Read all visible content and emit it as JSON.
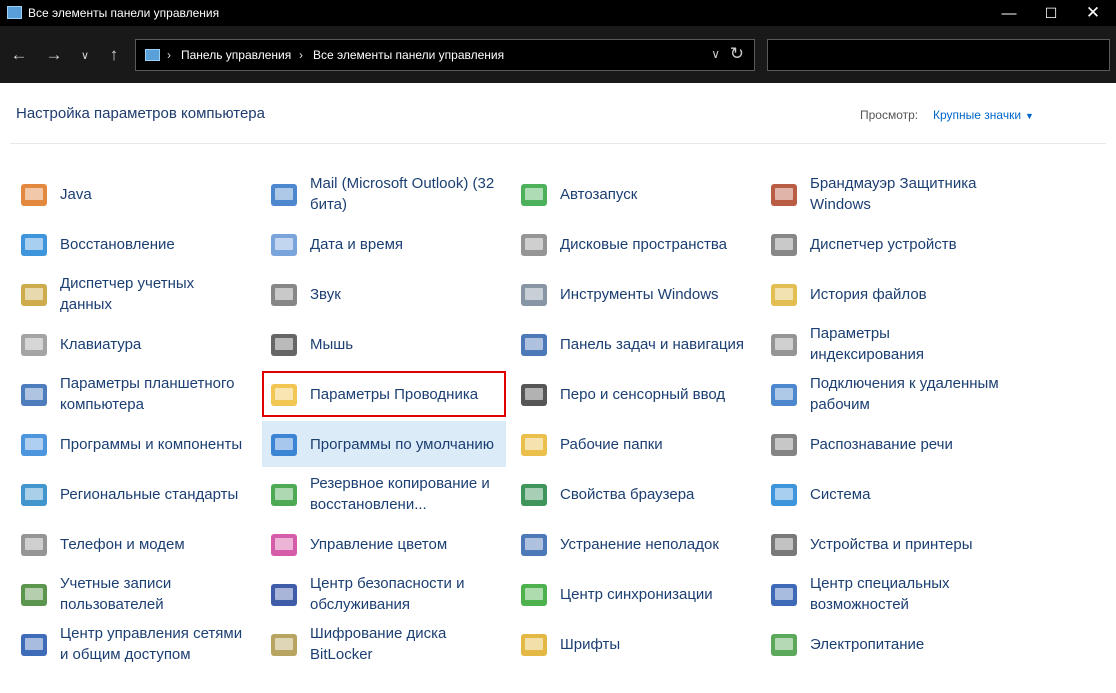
{
  "window": {
    "title": "Все элементы панели управления"
  },
  "address": {
    "crumbs": [
      "Панель управления",
      "Все элементы панели управления"
    ]
  },
  "heading": "Настройка параметров компьютера",
  "view": {
    "label": "Просмотр:",
    "value": "Крупные значки"
  },
  "columns": [
    [
      {
        "label": "Java",
        "icon": "java-icon",
        "color": "#e07b2a"
      },
      {
        "label": "Восстановление",
        "icon": "recovery-icon",
        "color": "#2a8ad8"
      },
      {
        "label": "Диспетчер учетных данных",
        "icon": "credential-manager-icon",
        "color": "#c9a33a"
      },
      {
        "label": "Клавиатура",
        "icon": "keyboard-icon",
        "color": "#9a9a9a"
      },
      {
        "label": "Параметры планшетного компьютера",
        "icon": "tablet-icon",
        "color": "#3a6fb5"
      },
      {
        "label": "Программы и компоненты",
        "icon": "programs-icon",
        "color": "#3a8ad8"
      },
      {
        "label": "Региональные стандарты",
        "icon": "globe-icon",
        "color": "#2f8ac8"
      },
      {
        "label": "Телефон и модем",
        "icon": "phone-icon",
        "color": "#8a8a8a"
      },
      {
        "label": "Учетные записи пользователей",
        "icon": "users-icon",
        "color": "#4a8a3a"
      },
      {
        "label": "Центр управления сетями и общим доступом",
        "icon": "network-icon",
        "color": "#2a5cb0"
      }
    ],
    [
      {
        "label": "Mail (Microsoft Outlook) (32 бита)",
        "icon": "mail-icon",
        "color": "#3a7ac8"
      },
      {
        "label": "Дата и время",
        "icon": "clock-icon",
        "color": "#6a9ad8"
      },
      {
        "label": "Звук",
        "icon": "speaker-icon",
        "color": "#7a7a7a"
      },
      {
        "label": "Мышь",
        "icon": "mouse-icon",
        "color": "#555555"
      },
      {
        "label": "Параметры Проводника",
        "icon": "folder-options-icon",
        "color": "#f0c040"
      },
      {
        "label": "Программы по умолчанию",
        "icon": "default-programs-icon",
        "color": "#2a7ad0"
      },
      {
        "label": "Резервное копирование и восстановлени...",
        "icon": "backup-icon",
        "color": "#3aa040"
      },
      {
        "label": "Управление цветом",
        "icon": "color-icon",
        "color": "#d04aa0"
      },
      {
        "label": "Центр безопасности и обслуживания",
        "icon": "flag-icon",
        "color": "#2a4aa0"
      },
      {
        "label": "Шифрование диска BitLocker",
        "icon": "bitlocker-icon",
        "color": "#b09a50"
      }
    ],
    [
      {
        "label": "Автозапуск",
        "icon": "autoplay-icon",
        "color": "#3aa84a"
      },
      {
        "label": "Дисковые пространства",
        "icon": "storage-icon",
        "color": "#8a8a8a"
      },
      {
        "label": "Инструменты Windows",
        "icon": "tools-icon",
        "color": "#7a8a9a"
      },
      {
        "label": "Панель задач и навигация",
        "icon": "taskbar-icon",
        "color": "#3a6ab0"
      },
      {
        "label": "Перо и сенсорный ввод",
        "icon": "pen-icon",
        "color": "#444444"
      },
      {
        "label": "Рабочие папки",
        "icon": "work-folders-icon",
        "color": "#e8b838"
      },
      {
        "label": "Свойства браузера",
        "icon": "browser-icon",
        "color": "#2a8a4a"
      },
      {
        "label": "Устранение неполадок",
        "icon": "troubleshoot-icon",
        "color": "#3a6ab0"
      },
      {
        "label": "Центр синхронизации",
        "icon": "sync-icon",
        "color": "#3aaa3a"
      },
      {
        "label": "Шрифты",
        "icon": "fonts-icon",
        "color": "#e0b030"
      }
    ],
    [
      {
        "label": "Брандмауэр Защитника Windows",
        "icon": "firewall-icon",
        "color": "#b04a30"
      },
      {
        "label": "Диспетчер устройств",
        "icon": "device-manager-icon",
        "color": "#7a7a7a"
      },
      {
        "label": "История файлов",
        "icon": "file-history-icon",
        "color": "#e0b840"
      },
      {
        "label": "Параметры индексирования",
        "icon": "indexing-icon",
        "color": "#8a8a8a"
      },
      {
        "label": "Подключения к удаленным рабочим",
        "icon": "remote-icon",
        "color": "#3a7ac8"
      },
      {
        "label": "Распознавание речи",
        "icon": "microphone-icon",
        "color": "#777777"
      },
      {
        "label": "Система",
        "icon": "system-icon",
        "color": "#2a8ad8"
      },
      {
        "label": "Устройства и принтеры",
        "icon": "printer-icon",
        "color": "#6a6a6a"
      },
      {
        "label": "Центр специальных возможностей",
        "icon": "accessibility-icon",
        "color": "#2a5ab0"
      },
      {
        "label": "Электропитание",
        "icon": "power-icon",
        "color": "#4aa04a"
      }
    ]
  ]
}
